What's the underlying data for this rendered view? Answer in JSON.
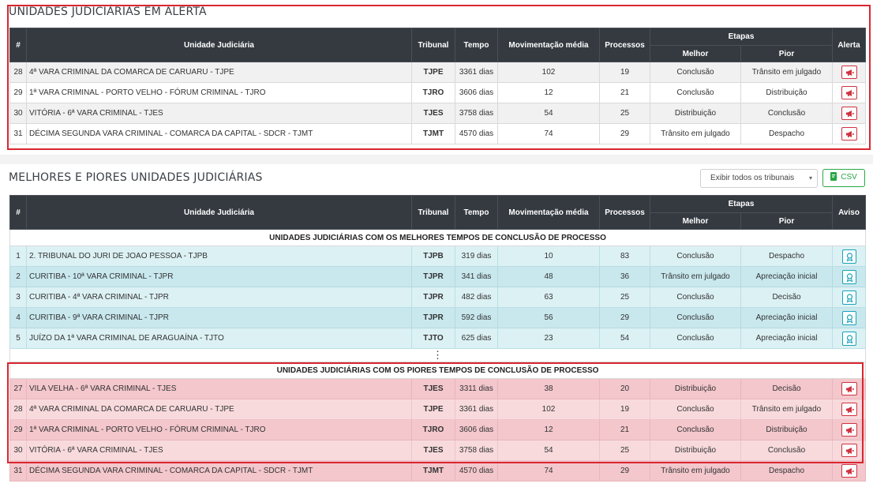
{
  "alert_panel": {
    "title": "UNIDADES JUDICIÁRIAS EM ALERTA",
    "headers": {
      "num": "#",
      "unit": "Unidade Judiciária",
      "court": "Tribunal",
      "time": "Tempo",
      "avg": "Movimentação média",
      "proc": "Processos",
      "stages": "Etapas",
      "best": "Melhor",
      "worst": "Pior",
      "alert": "Alerta"
    },
    "rows": [
      {
        "num": "28",
        "unit": "4ª VARA CRIMINAL DA COMARCA DE CARUARU - TJPE",
        "court": "TJPE",
        "time": "3361 dias",
        "avg": "102",
        "proc": "19",
        "best": "Conclusão",
        "worst": "Trânsito em julgado"
      },
      {
        "num": "29",
        "unit": "1ª VARA CRIMINAL - PORTO VELHO - FÓRUM CRIMINAL - TJRO",
        "court": "TJRO",
        "time": "3606 dias",
        "avg": "12",
        "proc": "21",
        "best": "Conclusão",
        "worst": "Distribuição"
      },
      {
        "num": "30",
        "unit": "VITÓRIA - 6ª VARA CRIMINAL - TJES",
        "court": "TJES",
        "time": "3758 dias",
        "avg": "54",
        "proc": "25",
        "best": "Distribuição",
        "worst": "Conclusão"
      },
      {
        "num": "31",
        "unit": "DÉCIMA SEGUNDA VARA CRIMINAL - COMARCA DA CAPITAL - SDCR - TJMT",
        "court": "TJMT",
        "time": "4570 dias",
        "avg": "74",
        "proc": "29",
        "best": "Trânsito em julgado",
        "worst": "Despacho"
      }
    ]
  },
  "ranking_panel": {
    "title": "MELHORES E PIORES UNIDADES JUDICIÁRIAS",
    "filter_select": "Exibir todos os tribunais",
    "csv_label": "CSV",
    "headers": {
      "num": "#",
      "unit": "Unidade Judiciária",
      "court": "Tribunal",
      "time": "Tempo",
      "avg": "Movimentação média",
      "proc": "Processos",
      "stages": "Etapas",
      "best": "Melhor",
      "worst": "Pior",
      "notice": "Aviso"
    },
    "best_section_label": "UNIDADES JUDICIÁRIAS COM OS MELHORES TEMPOS DE CONCLUSÃO DE PROCESSO",
    "best_rows": [
      {
        "num": "1",
        "unit": "2. TRIBUNAL DO JURI DE JOAO PESSOA - TJPB",
        "court": "TJPB",
        "time": "319 dias",
        "avg": "10",
        "proc": "83",
        "best": "Conclusão",
        "worst": "Despacho"
      },
      {
        "num": "2",
        "unit": "CURITIBA - 10ª VARA CRIMINAL - TJPR",
        "court": "TJPR",
        "time": "341 dias",
        "avg": "48",
        "proc": "36",
        "best": "Trânsito em julgado",
        "worst": "Apreciação inicial"
      },
      {
        "num": "3",
        "unit": "CURITIBA - 4ª VARA CRIMINAL - TJPR",
        "court": "TJPR",
        "time": "482 dias",
        "avg": "63",
        "proc": "25",
        "best": "Conclusão",
        "worst": "Decisão"
      },
      {
        "num": "4",
        "unit": "CURITIBA - 9ª VARA CRIMINAL - TJPR",
        "court": "TJPR",
        "time": "592 dias",
        "avg": "56",
        "proc": "29",
        "best": "Conclusão",
        "worst": "Apreciação inicial"
      },
      {
        "num": "5",
        "unit": "JUÍZO DA 1ª VARA CRIMINAL DE ARAGUAÍNA - TJTO",
        "court": "TJTO",
        "time": "625 dias",
        "avg": "23",
        "proc": "54",
        "best": "Conclusão",
        "worst": "Apreciação inicial"
      }
    ],
    "ellipsis": "⋮",
    "worst_section_label": "UNIDADES JUDICIÁRIAS COM OS PIORES TEMPOS DE CONCLUSÃO DE PROCESSO",
    "worst_rows": [
      {
        "num": "27",
        "unit": "VILA VELHA - 6ª VARA CRIMINAL - TJES",
        "court": "TJES",
        "time": "3311 dias",
        "avg": "38",
        "proc": "20",
        "best": "Distribuição",
        "worst": "Decisão"
      },
      {
        "num": "28",
        "unit": "4ª VARA CRIMINAL DA COMARCA DE CARUARU - TJPE",
        "court": "TJPE",
        "time": "3361 dias",
        "avg": "102",
        "proc": "19",
        "best": "Conclusão",
        "worst": "Trânsito em julgado"
      },
      {
        "num": "29",
        "unit": "1ª VARA CRIMINAL - PORTO VELHO - FÓRUM CRIMINAL - TJRO",
        "court": "TJRO",
        "time": "3606 dias",
        "avg": "12",
        "proc": "21",
        "best": "Conclusão",
        "worst": "Distribuição"
      },
      {
        "num": "30",
        "unit": "VITÓRIA - 6ª VARA CRIMINAL - TJES",
        "court": "TJES",
        "time": "3758 dias",
        "avg": "54",
        "proc": "25",
        "best": "Distribuição",
        "worst": "Conclusão"
      },
      {
        "num": "31",
        "unit": "DÉCIMA SEGUNDA VARA CRIMINAL - COMARCA DA CAPITAL - SDCR - TJMT",
        "court": "TJMT",
        "time": "4570 dias",
        "avg": "74",
        "proc": "29",
        "best": "Trânsito em julgado",
        "worst": "Despacho"
      }
    ]
  },
  "colors": {
    "header_dark": "#343a40",
    "alert_red": "#d0323f",
    "notice_teal": "#17a2b8",
    "csv_green": "#28a745",
    "highlight_outline": "#d9262f"
  }
}
